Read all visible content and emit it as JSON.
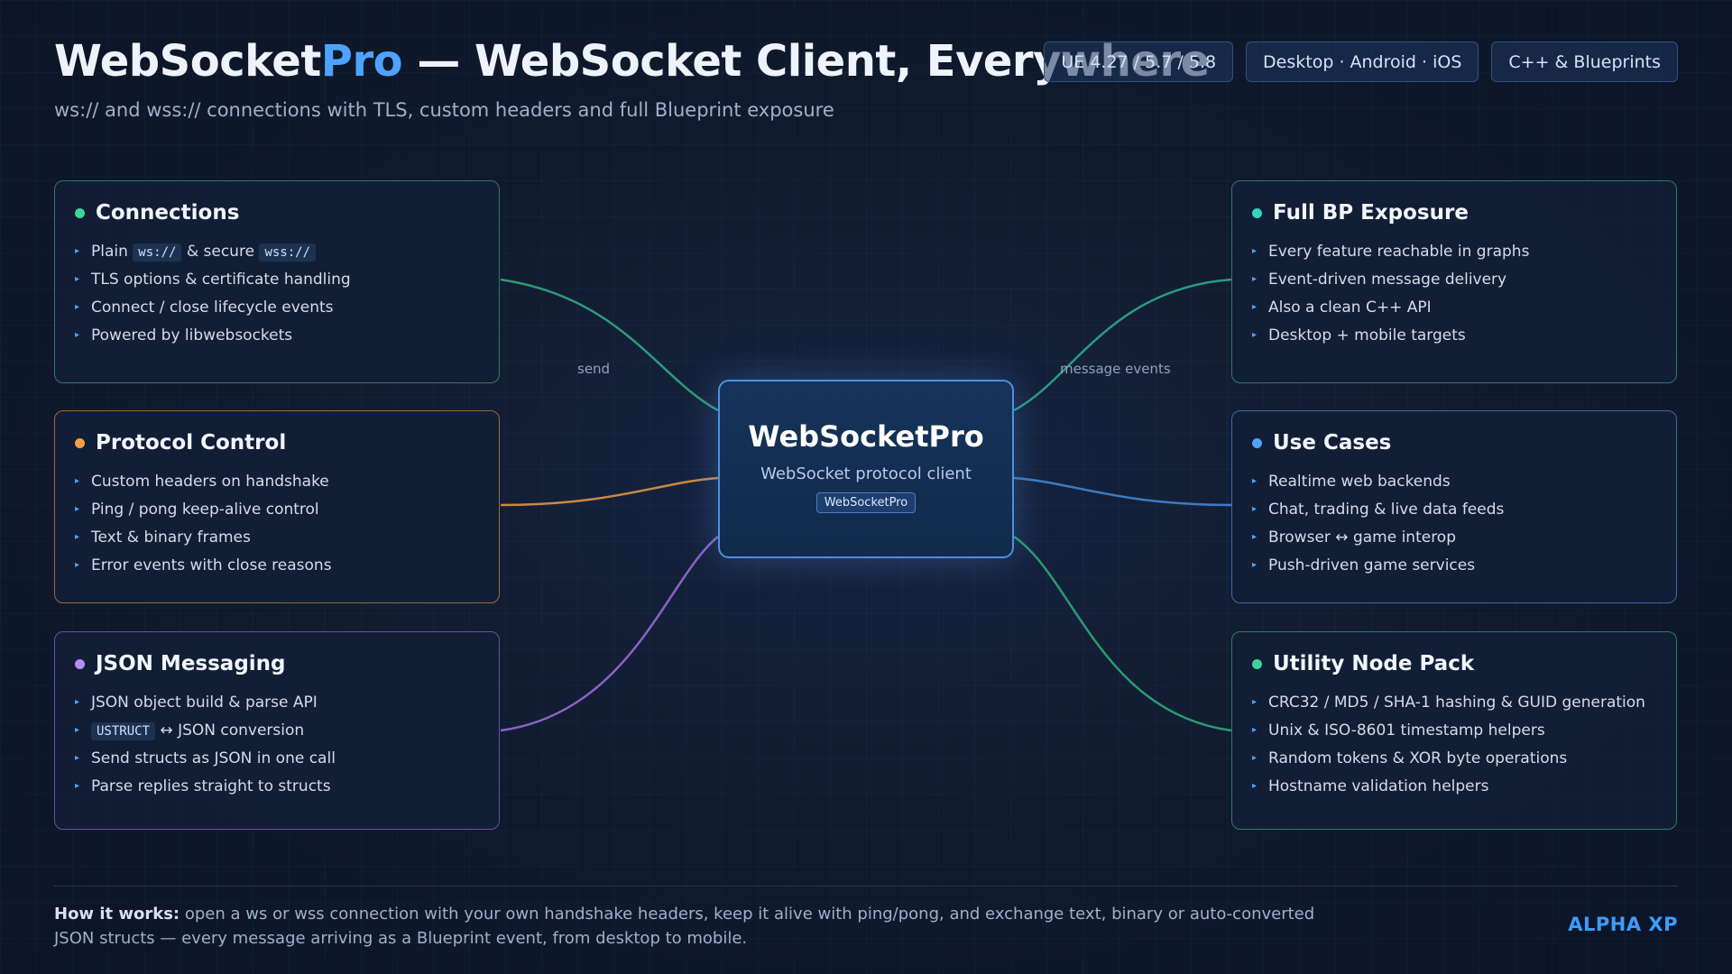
{
  "header": {
    "title_main": "WebSocket",
    "title_accent": "Pro",
    "title_rest": " — WebSocket Client, Everywhere",
    "subtitle": "ws:// and wss:// connections with TLS, custom headers and full Blueprint exposure",
    "badges": [
      "UE 4.27 / 5.7 / 5.8",
      "Desktop · Android · iOS",
      "C++ & Blueprints"
    ]
  },
  "center": {
    "title": "WebSocketPro",
    "subtitle": "WebSocket protocol client",
    "tag": "WebSocketPro"
  },
  "edge_labels": {
    "left": "send",
    "right": "message events"
  },
  "colors": {
    "green": "#3fd39a",
    "orange": "#f0a04a",
    "purple": "#b48cf5",
    "teal": "#35d3c0",
    "blue": "#4da3ff",
    "accent": "#4da3ff"
  },
  "cards": {
    "connections": {
      "title": "Connections",
      "items": [
        {
          "pre": "Plain ",
          "code1": "ws://",
          "mid": " & secure ",
          "code2": "wss://"
        },
        "TLS options & certificate handling",
        "Connect / close lifecycle events",
        "Powered by libwebsockets"
      ]
    },
    "protocol": {
      "title": "Protocol Control",
      "items": [
        "Custom headers on handshake",
        "Ping / pong keep-alive control",
        "Text & binary frames",
        "Error events with close reasons"
      ]
    },
    "json": {
      "title": "JSON Messaging",
      "items": [
        "JSON object build & parse API",
        {
          "code": "USTRUCT",
          "post": " ↔ JSON conversion"
        },
        "Send structs as JSON in one call",
        "Parse replies straight to structs"
      ]
    },
    "bp": {
      "title": "Full BP Exposure",
      "items": [
        "Every feature reachable in graphs",
        "Event-driven message delivery",
        "Also a clean C++ API",
        "Desktop + mobile targets"
      ]
    },
    "usecases": {
      "title": "Use Cases",
      "items": [
        "Realtime web backends",
        "Chat, trading & live data feeds",
        "Browser ↔ game interop",
        "Push-driven game services"
      ]
    },
    "utility": {
      "title": "Utility Node Pack",
      "items": [
        "CRC32 / MD5 / SHA-1 hashing & GUID generation",
        "Unix & ISO-8601 timestamp helpers",
        "Random tokens & XOR byte operations",
        "Hostname validation helpers"
      ]
    }
  },
  "footer": {
    "lead": "How it works:",
    "text": " open a ws or wss connection with your own handshake headers, keep it alive with ping/pong, and exchange text, binary or auto-converted JSON structs — every message arriving as a Blueprint event, from desktop to mobile.",
    "brand": "ALPHA XP"
  }
}
